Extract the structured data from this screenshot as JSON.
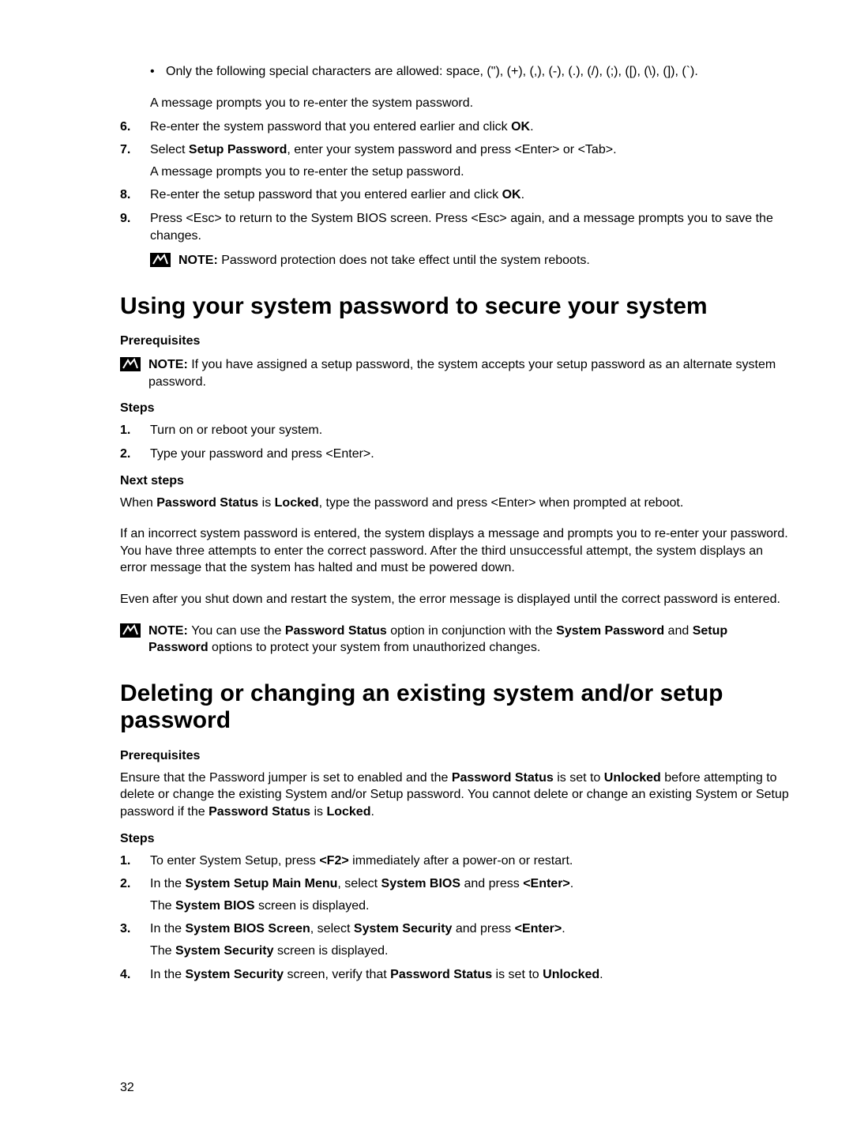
{
  "intro": {
    "bullet": "Only the following special characters are allowed: space, (\"), (+), (,), (-), (.), (/), (;), ([), (\\), (]), (`).",
    "after_bullet": "A message prompts you to re-enter the system password."
  },
  "list1": {
    "item6": {
      "num": "6.",
      "prefix": "Re-enter the system password that you entered earlier and click ",
      "ok": "OK",
      "suffix": "."
    },
    "item7": {
      "num": "7.",
      "prefix": "Select ",
      "bold1": "Setup Password",
      "suffix": ", enter your system password and press <Enter> or <Tab>.",
      "line2": "A message prompts you to re-enter the setup password."
    },
    "item8": {
      "num": "8.",
      "prefix": "Re-enter the setup password that you entered earlier and click ",
      "ok": "OK",
      "suffix": "."
    },
    "item9": {
      "num": "9.",
      "text": "Press <Esc> to return to the System BIOS screen. Press <Esc> again, and a message prompts you to save the changes."
    },
    "note": {
      "label": "NOTE: ",
      "text": "Password protection does not take effect until the system reboots."
    }
  },
  "section1": {
    "title": "Using your system password to secure your system",
    "prereq_h": "Prerequisites",
    "note": {
      "label": "NOTE: ",
      "text": "If you have assigned a setup password, the system accepts your setup password as an alternate system password."
    },
    "steps_h": "Steps",
    "step1": {
      "num": "1.",
      "text": "Turn on or reboot your system."
    },
    "step2": {
      "num": "2.",
      "text": "Type your password and press <Enter>."
    },
    "next_h": "Next steps",
    "next_p1_pre": "When ",
    "next_p1_b1": "Password Status",
    "next_p1_mid": " is ",
    "next_p1_b2": "Locked",
    "next_p1_post": ", type the password and press <Enter> when prompted at reboot.",
    "next_p2": "If an incorrect system password is entered, the system displays a message and prompts you to re-enter your password. You have three attempts to enter the correct password. After the third unsuccessful attempt, the system displays an error message that the system has halted and must be powered down.",
    "next_p3": "Even after you shut down and restart the system, the error message is displayed until the correct password is entered.",
    "note2": {
      "label": "NOTE: ",
      "pre": "You can use the ",
      "b1": "Password Status",
      "mid": " option in conjunction with the ",
      "b2": "System Password",
      "post1": " and ",
      "b3": "Setup Password",
      "post2": " options to protect your system from unauthorized changes."
    }
  },
  "section2": {
    "title": "Deleting or changing an existing system and/or setup password",
    "prereq_h": "Prerequisites",
    "prereq_p_pre": "Ensure that the Password jumper is set to enabled and the ",
    "prereq_b1": "Password Status",
    "prereq_mid1": " is set to ",
    "prereq_b2": "Unlocked",
    "prereq_mid2": " before attempting to delete or change the existing System and/or Setup password. You cannot delete or change an existing System or Setup password if the ",
    "prereq_b3": "Password Status",
    "prereq_mid3": " is ",
    "prereq_b4": "Locked",
    "prereq_post": ".",
    "steps_h": "Steps",
    "s1": {
      "num": "1.",
      "pre": "To enter System Setup, press ",
      "b1": "<F2>",
      "post": " immediately after a power-on or restart."
    },
    "s2": {
      "num": "2.",
      "pre": "In the ",
      "b1": "System Setup Main Menu",
      "mid": ", select ",
      "b2": "System BIOS",
      "post1": " and press ",
      "b3": "<Enter>",
      "post2": ".",
      "line2_pre": "The ",
      "line2_b": "System BIOS",
      "line2_post": " screen is displayed."
    },
    "s3": {
      "num": "3.",
      "pre": "In the ",
      "b1": "System BIOS Screen",
      "mid": ", select ",
      "b2": "System Security",
      "post1": " and press ",
      "b3": "<Enter>",
      "post2": ".",
      "line2_pre": "The ",
      "line2_b": "System Security",
      "line2_post": " screen is displayed."
    },
    "s4": {
      "num": "4.",
      "pre": "In the ",
      "b1": "System Security",
      "mid": " screen, verify that ",
      "b2": "Password Status",
      "post1": " is set to ",
      "b3": "Unlocked",
      "post2": "."
    }
  },
  "page_number": "32"
}
